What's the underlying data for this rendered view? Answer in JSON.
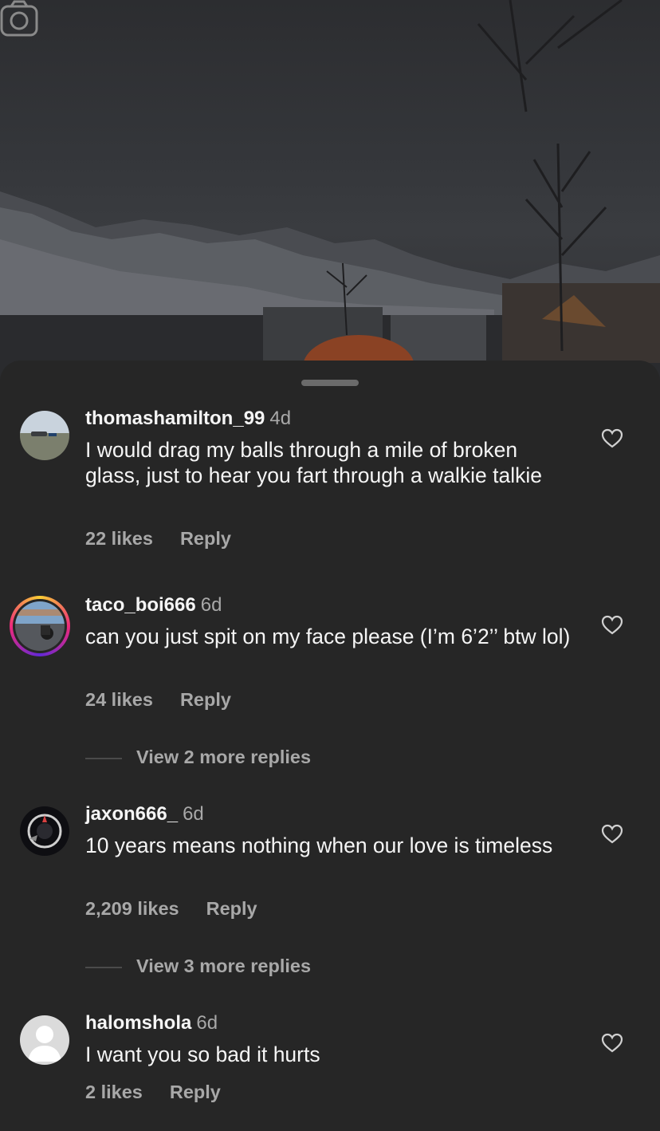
{
  "comments": [
    {
      "username": "thomashamilton_99",
      "time": "4d",
      "text": "I would drag my balls through a mile of broken glass, just to hear you fart through a walkie talkie",
      "likes": "22 likes",
      "reply": "Reply",
      "avatar": "car-photo-avatar"
    },
    {
      "username": "taco_boi666",
      "time": "6d",
      "text": "can you just spit on my face please (I’m 6’2’’ btw lol)",
      "likes": "24 likes",
      "reply": "Reply",
      "avatar": "motorcycle-photo-avatar",
      "story_ring": true,
      "view_more": "View 2 more replies"
    },
    {
      "username": "jaxon666_",
      "time": "6d",
      "text": "10 years means nothing when our love is timeless",
      "likes": "2,209 likes",
      "reply": "Reply",
      "avatar": "dark-photo-avatar",
      "view_more": "View 3 more replies"
    },
    {
      "username": "halomshola",
      "time": "6d",
      "text": "I want you so bad it hurts",
      "likes": "2 likes",
      "reply": "Reply",
      "avatar": "default-avatar"
    }
  ],
  "icons": {
    "camera": "camera-icon",
    "heart": "heart-icon"
  },
  "colors": {
    "background": "#262626",
    "secondary_text": "#a8a8a8",
    "primary_text": "#f5f5f5"
  }
}
